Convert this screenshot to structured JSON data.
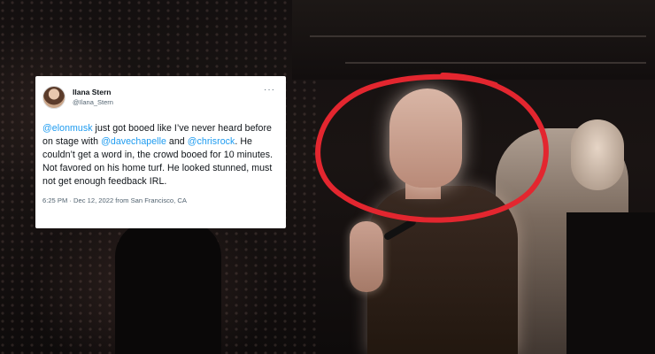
{
  "tweet": {
    "display_name": "Ilana Stern",
    "handle": "@Ilana_Stern",
    "more_label": "···",
    "body": [
      {
        "type": "mention",
        "text": "@elonmusk"
      },
      {
        "type": "text",
        "text": " just got booed like I’ve never heard before on stage with "
      },
      {
        "type": "mention",
        "text": "@davechapelle"
      },
      {
        "type": "text",
        "text": " and "
      },
      {
        "type": "mention",
        "text": "@chrisrock"
      },
      {
        "type": "text",
        "text": ". He couldn’t get a word in, the crowd booed for 10 minutes. Not favored on his home turf. He looked stunned, must not get enough feedback IRL."
      }
    ],
    "timestamp": "6:25 PM · Dec 12, 2022 from San Francisco, CA",
    "mention_color": "#1d9bf0"
  },
  "annotation": {
    "circle_color": "#e3262f"
  }
}
